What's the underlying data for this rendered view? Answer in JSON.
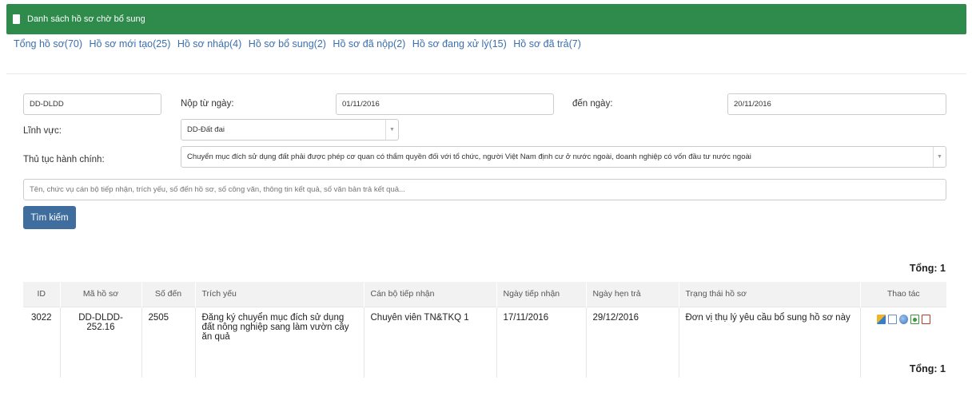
{
  "header": {
    "title": "Danh sách hồ sơ chờ bổ sung"
  },
  "tabs": [
    "Tổng hồ sơ(70)",
    "Hồ sơ mới tạo(25)",
    "Hồ sơ nháp(4)",
    "Hồ sơ bổ sung(2)",
    "Hồ sơ đã nộp(2)",
    "Hồ sơ đang xử lý(15)",
    "Hồ sơ đã trả(7)"
  ],
  "form": {
    "code_value": "DD-DLDD",
    "from_label": "Nộp từ ngày:",
    "from_value": "01/11/2016",
    "to_label": "đến ngày:",
    "to_value": "20/11/2016",
    "field_label": "Lĩnh vực:",
    "field_value": "DD-Đất đai",
    "procedure_label": "Thủ tục hành chính:",
    "procedure_value": "Chuyển mục đích sử dụng đất phải được phép cơ quan có thẩm quyền đối với tổ chức, người Việt Nam định cư ở nước ngoài, doanh nghiệp có vốn đầu tư nước ngoài",
    "search_placeholder": "Tên, chức vụ cán bộ tiếp nhận, trích yếu, số đến hồ sơ, số công văn, thông tin kết quả, số văn bản trả kết quả...",
    "search_button": "Tìm kiếm"
  },
  "total_label": "Tổng: 1",
  "table": {
    "headers": [
      "ID",
      "Mã hồ sơ",
      "Số đến",
      "Trích yếu",
      "Cán bộ tiếp nhận",
      "Ngày tiếp nhận",
      "Ngày hẹn trả",
      "Trạng thái hồ sơ",
      "Thao tác"
    ],
    "rows": [
      {
        "id": "3022",
        "code": "DD-DLDD-252.16",
        "number": "2505",
        "summary": "Đăng ký chuyển mục đích sử dụng đất nông nghiệp sang làm vườn cây ăn quả",
        "officer": "Chuyên viên TN&TKQ 1",
        "received": "17/11/2016",
        "due": "29/12/2016",
        "status": "Đơn vị thụ lý yêu cầu bổ sung hồ sơ này"
      }
    ]
  },
  "action_icons": [
    "book-icon",
    "list-icon",
    "send-icon",
    "refresh-icon",
    "pdf-icon"
  ]
}
